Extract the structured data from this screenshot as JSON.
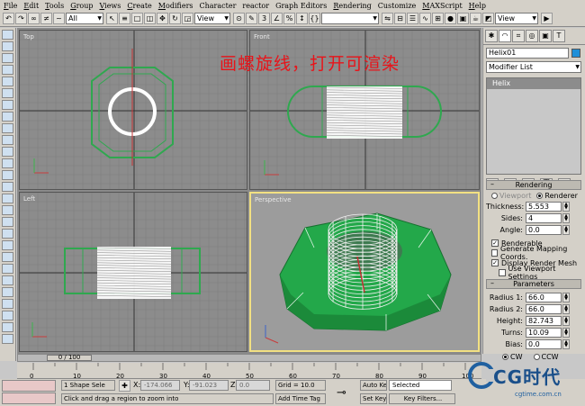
{
  "menu": [
    {
      "key": "F",
      "rest": "ile"
    },
    {
      "key": "E",
      "rest": "dit"
    },
    {
      "key": "T",
      "rest": "ools"
    },
    {
      "key": "G",
      "rest": "roup"
    },
    {
      "key": "V",
      "rest": "iews"
    },
    {
      "key": "C",
      "rest": "reate"
    },
    {
      "key": "M",
      "rest": "odifiers"
    },
    {
      "key": "",
      "rest": "Character"
    },
    {
      "key": "",
      "rest": "reactor"
    },
    {
      "key": "",
      "rest": "Graph Editors"
    },
    {
      "key": "R",
      "rest": "endering"
    },
    {
      "key": "",
      "rest": "Customize"
    },
    {
      "key": "M",
      "rest": "AXScript"
    },
    {
      "key": "H",
      "rest": "elp"
    }
  ],
  "toolbar": {
    "selection_filter": "All",
    "ref_coord": "View",
    "ref_coord_right": "View"
  },
  "viewports": {
    "top_label": "Top",
    "front_label": "Front",
    "left_label": "Left",
    "perspective_label": "Perspective"
  },
  "caption": "画螺旋线，打开可渲染",
  "command_panel": {
    "object_name": "Helix01",
    "object_color": "#1e8fd8",
    "modifier_list": "Modifier List",
    "stack_item": "Helix",
    "rendering_title": "Rendering",
    "viewport_label": "Viewport",
    "renderer_label": "Renderer",
    "thickness_label": "Thickness:",
    "thickness": "5.553",
    "sides_label": "Sides:",
    "sides": "4",
    "angle_label": "Angle:",
    "angle": "0.0",
    "renderable_label": "Renderable",
    "gen_mapping_label": "Generate Mapping Coords.",
    "display_render_mesh_label": "Display Render Mesh",
    "use_viewport_label": "Use Viewport Settings",
    "parameters_title": "Parameters",
    "radius1_label": "Radius 1:",
    "radius1": "66.0",
    "radius2_label": "Radius 2:",
    "radius2": "66.0",
    "height_label": "Height:",
    "height": "82.743",
    "turns_label": "Turns:",
    "turns": "10.09",
    "bias_label": "Bias:",
    "bias": "0.0",
    "cw_label": "CW",
    "ccw_label": "CCW"
  },
  "timeline": {
    "frame": "0 / 100",
    "ticks": [
      "0",
      "10",
      "20",
      "30",
      "40",
      "50",
      "60",
      "70",
      "80",
      "90",
      "100"
    ]
  },
  "status": {
    "selection": "1 Shape Sele",
    "x_label": "X:",
    "x": "-174.066",
    "y_label": "Y:",
    "y": "-91.023",
    "z_label": "Z:",
    "z": "0.0",
    "grid": "Grid = 10.0",
    "prompt": "Click and drag a region to zoom into",
    "add_time_tag": "Add Time Tag",
    "auto_key": "Auto Key",
    "set_key": "Set Key",
    "selected": "Selected",
    "key_filters": "Key Filters..."
  },
  "logo": {
    "text": "CG时代",
    "url": "cgtime.com.cn"
  }
}
